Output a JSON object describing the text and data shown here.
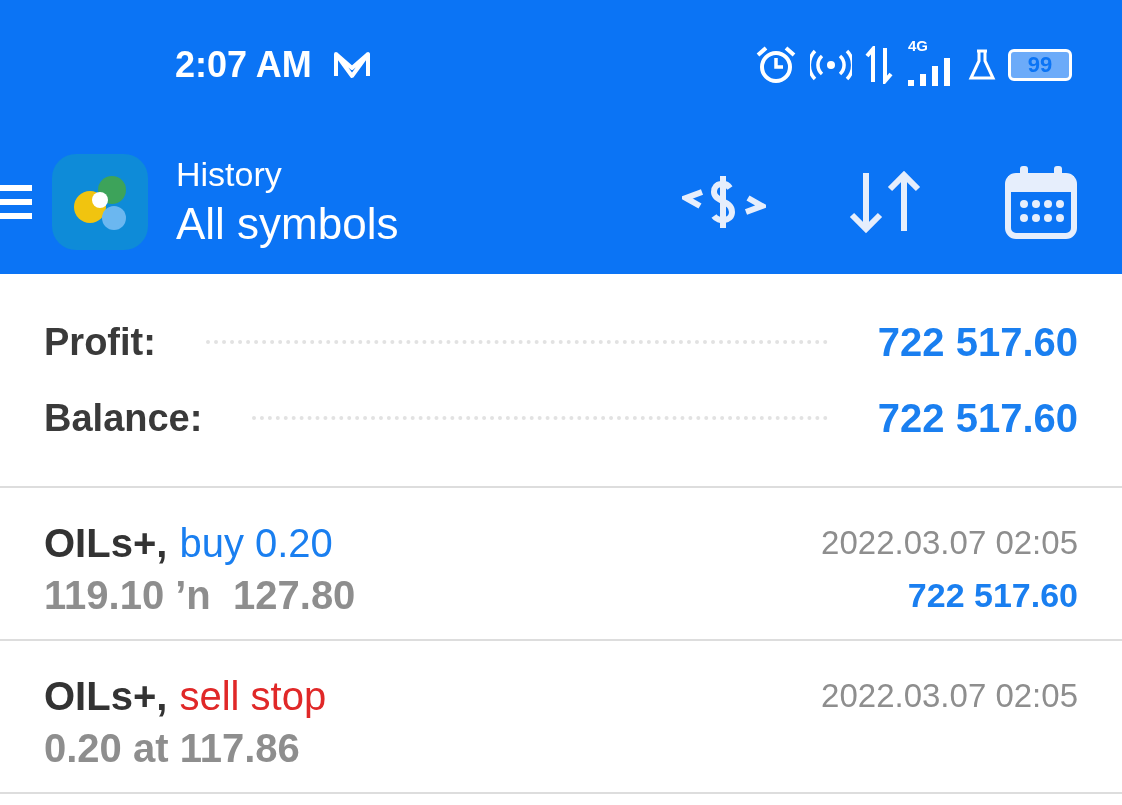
{
  "status_bar": {
    "time": "2:07 AM",
    "network_label": "4G",
    "battery": "99"
  },
  "header": {
    "subtitle": "History",
    "title": "All symbols"
  },
  "summary": [
    {
      "label": "Profit:",
      "value": "722 517.60"
    },
    {
      "label": "Balance:",
      "value": "722 517.60"
    }
  ],
  "deals": [
    {
      "symbol": "OILs+,",
      "type": "buy 0.20",
      "color": "#1a7ff0",
      "detail": "119.10 ’n  127.80",
      "time": "2022.03.07 02:05",
      "profit": "722 517.60"
    },
    {
      "symbol": "OILs+,",
      "type": "sell stop",
      "color": "#e02828",
      "detail": "0.20 at 117.86",
      "time": "2022.03.07 02:05"
    }
  ]
}
